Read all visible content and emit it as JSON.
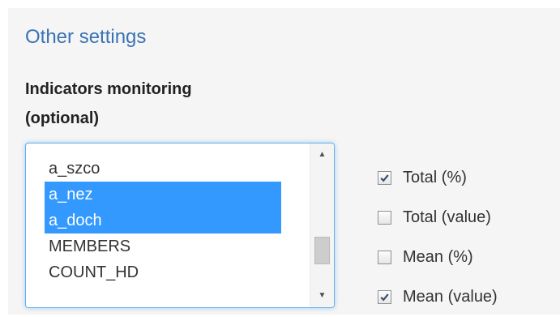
{
  "section": {
    "title": "Other settings"
  },
  "indicators": {
    "label_line1": "Indicators monitoring",
    "label_line2": "(optional)",
    "options": [
      {
        "label": "a_szco",
        "selected": false
      },
      {
        "label": "a_nez",
        "selected": true
      },
      {
        "label": "a_doch",
        "selected": true
      },
      {
        "label": "MEMBERS",
        "selected": false
      },
      {
        "label": "COUNT_HD",
        "selected": false
      }
    ],
    "scrollbar": {
      "up_icon": "triangle-up",
      "down_icon": "triangle-down"
    }
  },
  "options": [
    {
      "label": "Total (%)",
      "checked": true
    },
    {
      "label": "Total (value)",
      "checked": false
    },
    {
      "label": "Mean (%)",
      "checked": false
    },
    {
      "label": "Mean (value)",
      "checked": true
    }
  ],
  "colors": {
    "title": "#3a73b5",
    "selection": "#3399ff",
    "focus_border": "#66afe9",
    "panel_background": "#f5f5f5"
  }
}
